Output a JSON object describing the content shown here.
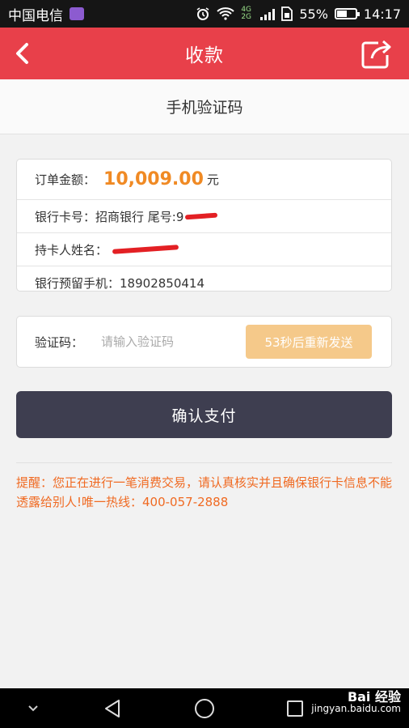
{
  "status_bar": {
    "carrier": "中国电信",
    "network": "4G 2G",
    "battery": "55%",
    "battery_level": 0.55,
    "time": "14:17"
  },
  "header": {
    "title": "收款",
    "back_icon": "chevron-left-icon",
    "share_icon": "share-external-icon"
  },
  "sub_header": {
    "title": "手机验证码"
  },
  "order": {
    "amount_label": "订单金额：",
    "amount": "10,009.00",
    "currency": "元",
    "bank_card_label": "银行卡号：",
    "bank_card_value": "招商银行 尾号:9",
    "holder_label": "持卡人姓名：",
    "phone_label": "银行预留手机：",
    "phone_value": "18902850414"
  },
  "verification": {
    "label": "验证码：",
    "placeholder": "请输入验证码",
    "resend_button": "53秒后重新发送"
  },
  "confirm_button": "确认支付",
  "notice": "提醒：您正在进行一笔消费交易，请认真核实并且确保银行卡信息不能透露给别人!唯一热线：400-057-2888",
  "watermark": {
    "brand": "Bai 经验",
    "url": "jingyan.baidu.com"
  },
  "colors": {
    "header": "#e8404a",
    "amount": "#f08a24",
    "resend": "#f5c98a",
    "confirm": "#3e3e50",
    "notice": "#f06a22"
  }
}
